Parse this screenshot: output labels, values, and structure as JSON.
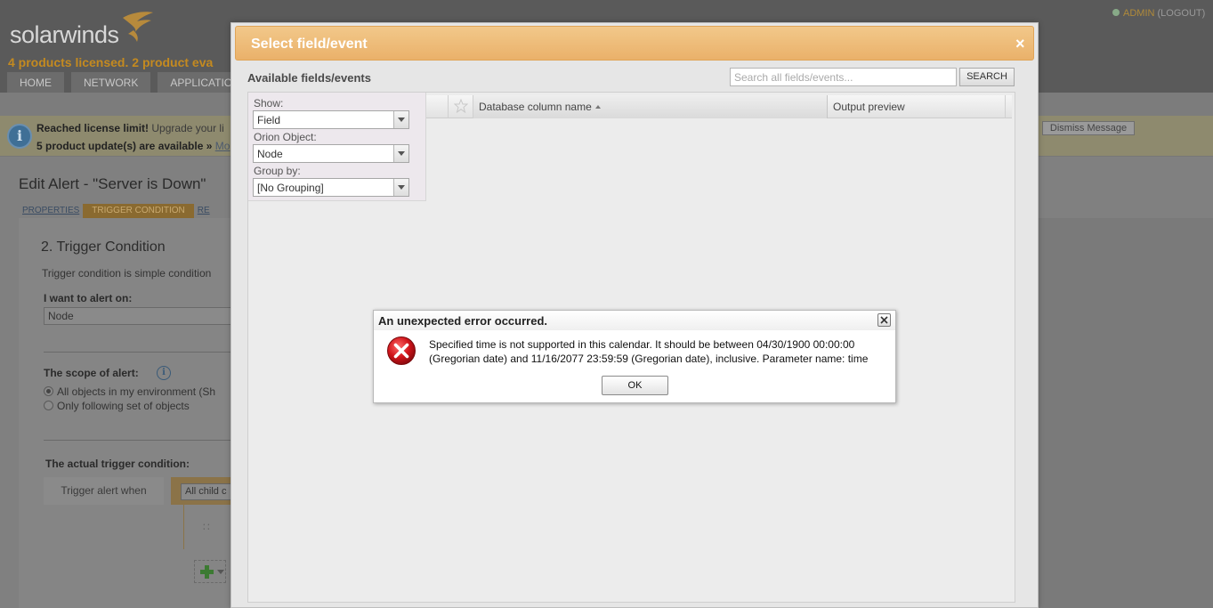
{
  "app": {
    "logo_text": "solarwinds",
    "licensed_text": "4 products licensed.  2 product eva",
    "user": {
      "admin_label": "ADMIN",
      "logout_label": "(LOGOUT)"
    }
  },
  "nav": {
    "tabs": [
      "HOME",
      "NETWORK",
      "APPLICATIO"
    ]
  },
  "notice": {
    "limit_bold": "Reached license limit!",
    "limit_rest": "  Upgrade your li",
    "updates": "5 product update(s) are available",
    "more_prefix": " » ",
    "more_link": "Mo",
    "dismiss_label": "Dismiss Message"
  },
  "edit_alert": {
    "title": "Edit Alert - \"Server is Down\"",
    "breadcrumbs": [
      "PROPERTIES",
      "TRIGGER CONDITION",
      "RE"
    ],
    "section_title": "2. Trigger Condition",
    "section_desc": "Trigger condition is simple condition",
    "alert_on_label": "I want to alert on:",
    "alert_on_value": "Node",
    "scope_label": "The scope of alert:",
    "scope_options": [
      "All objects in my environment (Sh",
      "Only following set of objects"
    ],
    "actual_label": "The actual trigger condition:",
    "trigger_when": "Trigger alert when",
    "trigger_select": "All child c",
    "tree_node_text": "∷"
  },
  "modal": {
    "title": "Select field/event",
    "close_glyph": "×",
    "available_label": "Available fields/events",
    "search_placeholder": "Search all fields/events...",
    "search_button": "SEARCH",
    "filters": {
      "show_label": "Show:",
      "show_value": "Field",
      "object_label": "Orion Object:",
      "object_value": "Node",
      "group_label": "Group by:",
      "group_value": "[No Grouping]"
    },
    "columns": {
      "db_column": "Database column name",
      "output_preview": "Output preview"
    }
  },
  "error_dialog": {
    "title": "An unexpected error occurred.",
    "message": "Specified time is not supported in this calendar. It should be between 04/30/1900 00:00:00 (Gregorian date) and 11/16/2077 23:59:59 (Gregorian date), inclusive. Parameter name: time",
    "ok_label": "OK"
  },
  "colors": {
    "modal_header": "#eab16a",
    "error_red": "#d0141a",
    "overlay_gray": "#808080"
  }
}
